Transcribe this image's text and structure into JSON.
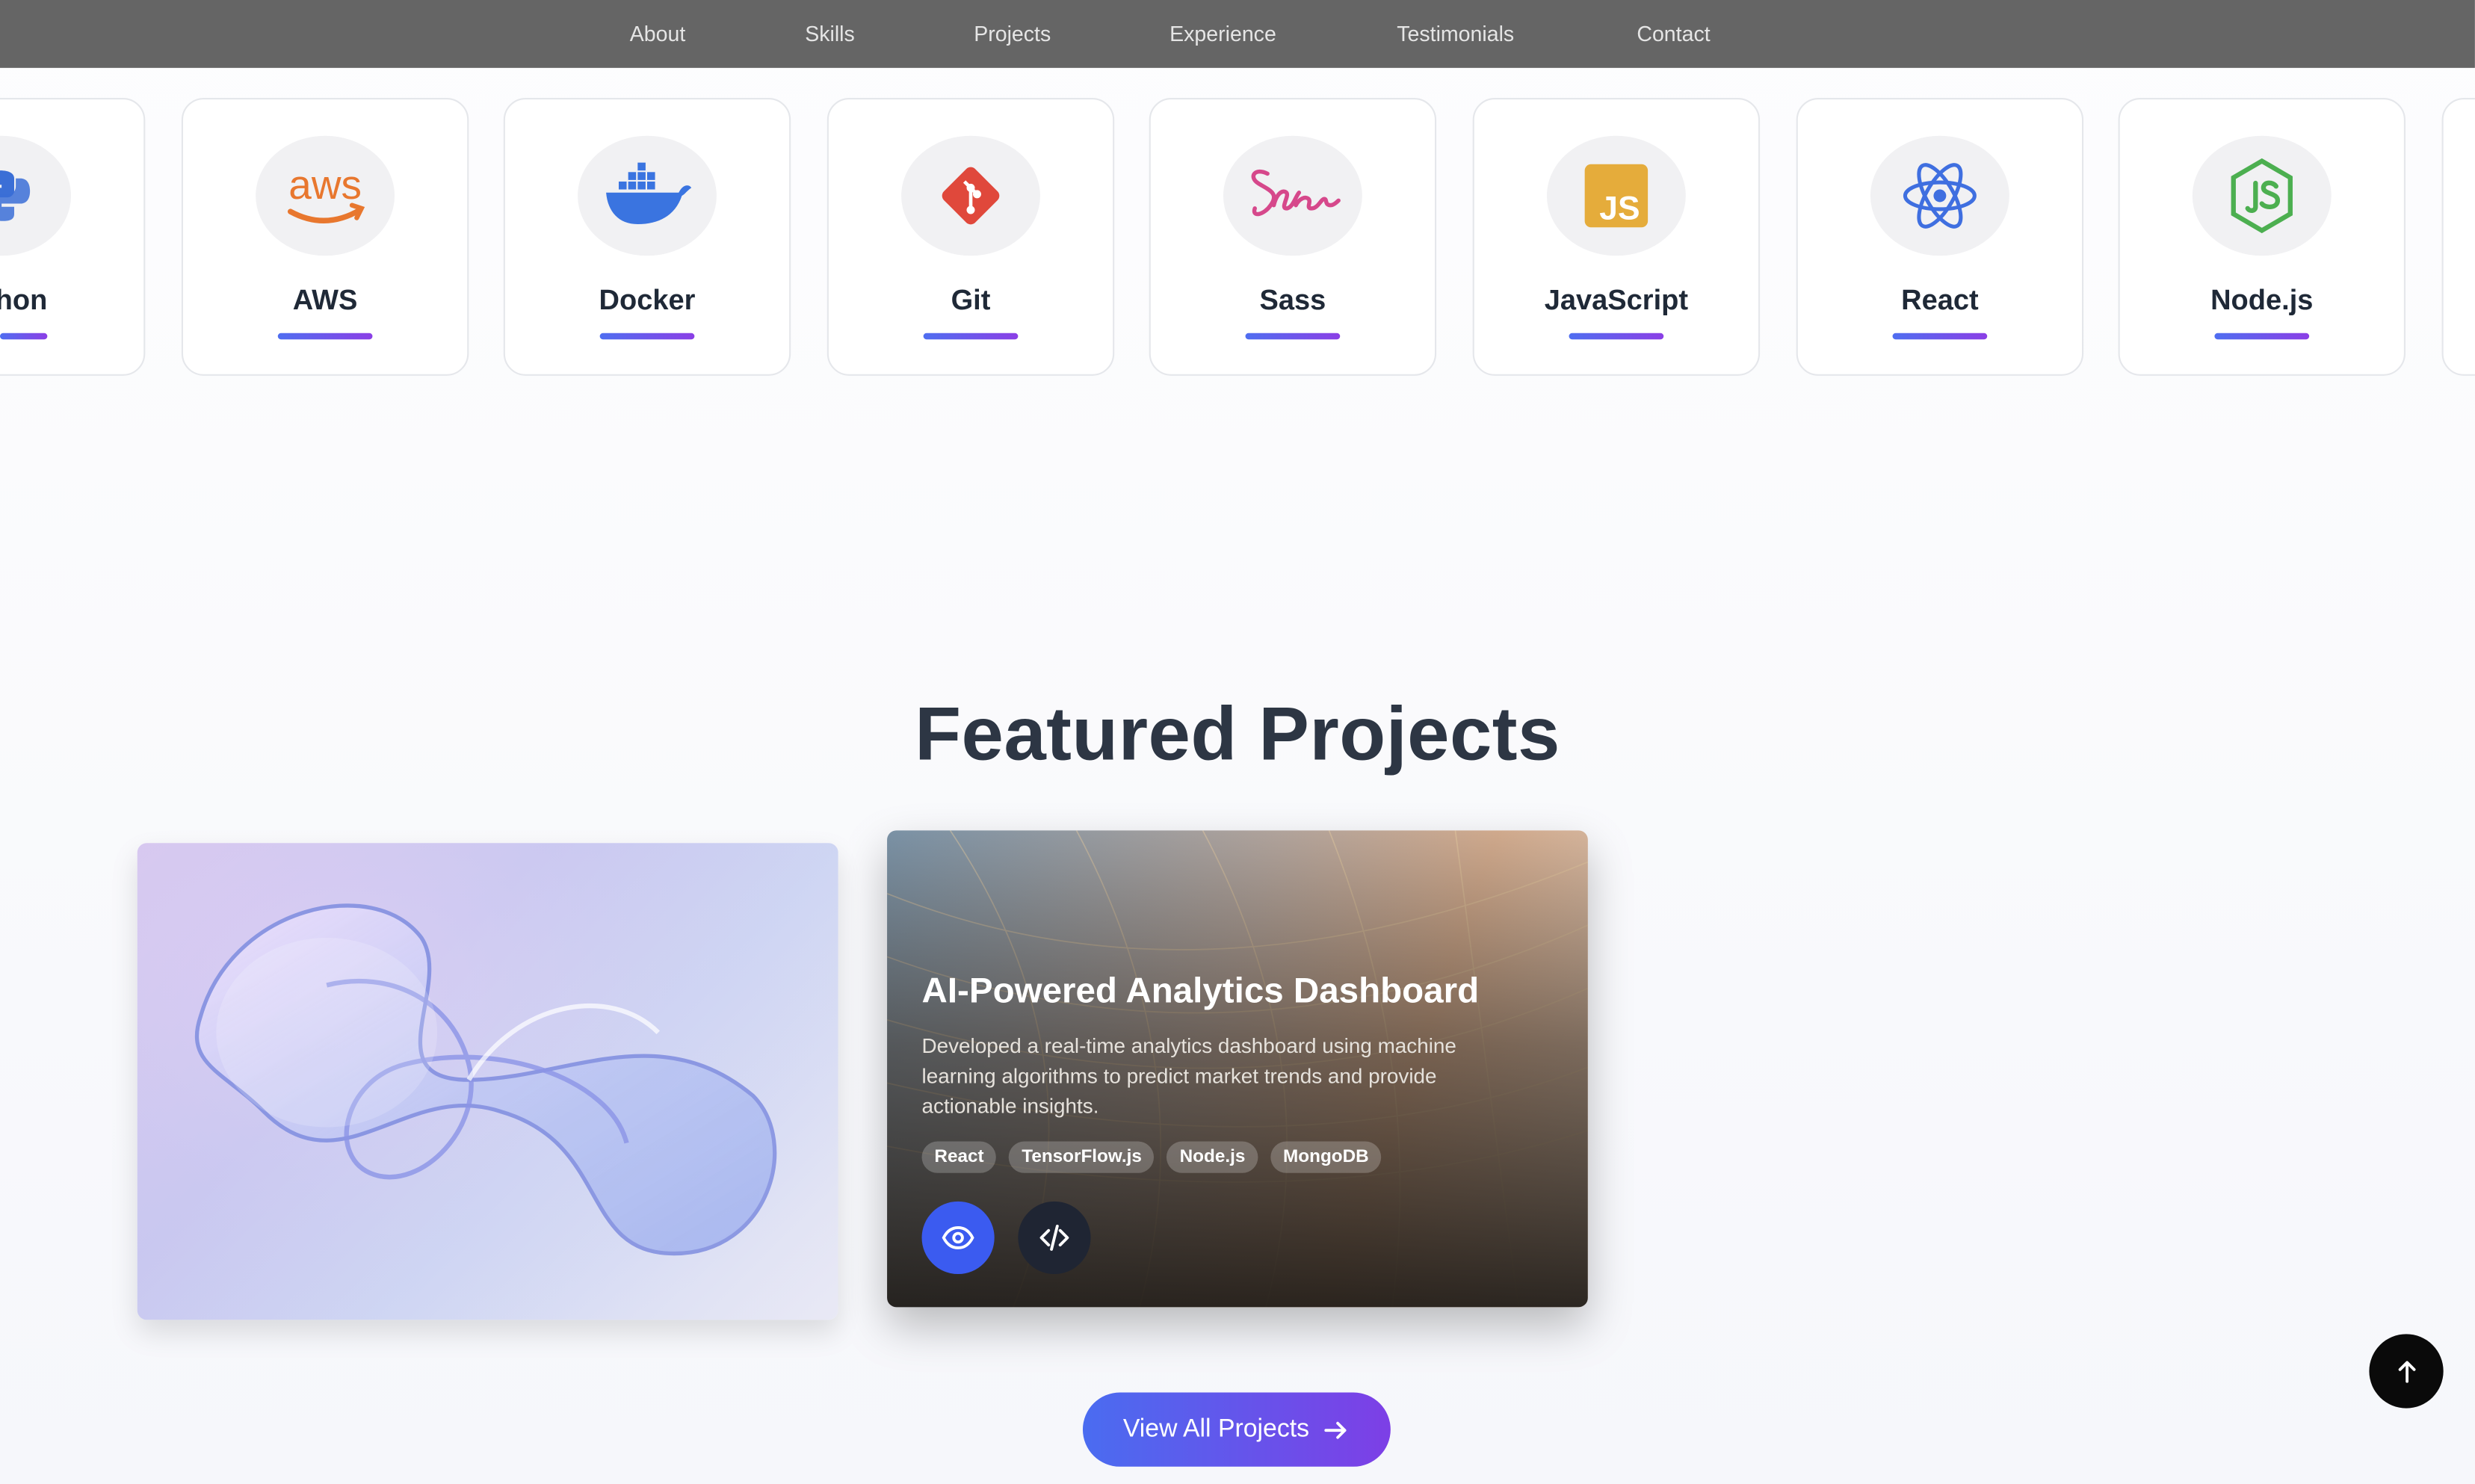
{
  "nav": {
    "items": [
      "About",
      "Skills",
      "Projects",
      "Experience",
      "Testimonials",
      "Contact"
    ]
  },
  "skills": [
    {
      "name": "hon",
      "icon": "python-icon"
    },
    {
      "name": "AWS",
      "icon": "aws-icon"
    },
    {
      "name": "Docker",
      "icon": "docker-icon"
    },
    {
      "name": "Git",
      "icon": "git-icon"
    },
    {
      "name": "Sass",
      "icon": "sass-icon"
    },
    {
      "name": "JavaScript",
      "icon": "javascript-icon"
    },
    {
      "name": "React",
      "icon": "react-icon"
    },
    {
      "name": "Node.js",
      "icon": "nodejs-icon"
    }
  ],
  "featured": {
    "title": "Featured Projects",
    "project": {
      "title": "AI-Powered Analytics Dashboard",
      "description": "Developed a real-time analytics dashboard using machine learning algorithms to predict market trends and provide actionable insights.",
      "tags": [
        "React",
        "TensorFlow.js",
        "Node.js",
        "MongoDB"
      ]
    },
    "view_all_label": "View All Projects"
  },
  "icons": {
    "aws_text": "aws",
    "js_text": "JS"
  },
  "colors": {
    "accent_start": "#4a6cf0",
    "accent_end": "#7d3fe6",
    "nav_bg": "#656565"
  }
}
